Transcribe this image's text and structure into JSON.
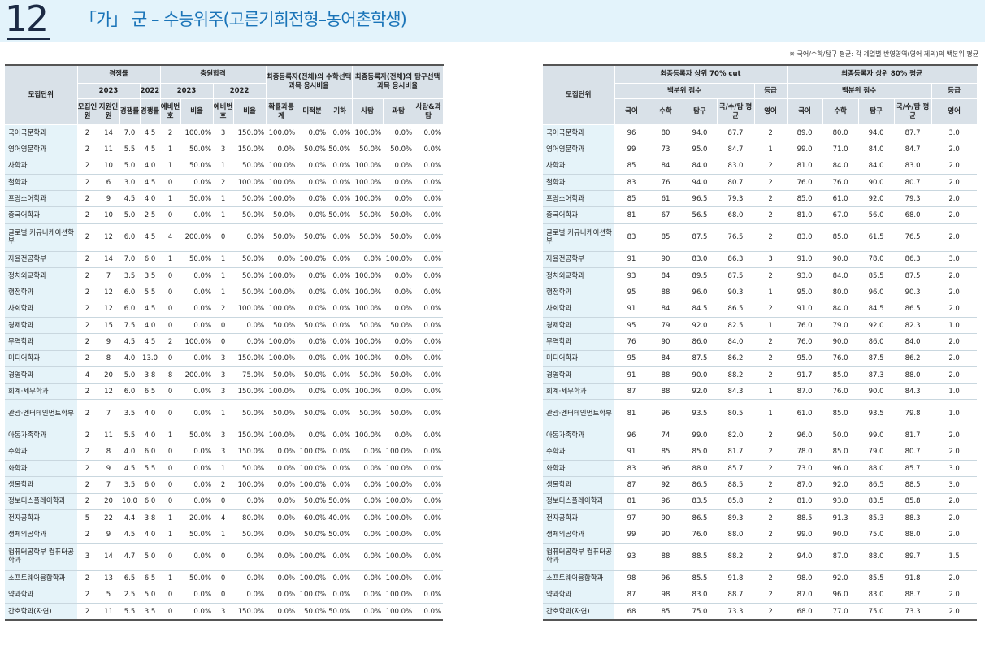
{
  "header": {
    "page_number": "12",
    "title": "「가」 군 – 수능위주(고른기회전형–농어촌학생)"
  },
  "note": "※ 국어/수학/탐구 평균: 각 계열별 반영영역(영어 제외)의 백분위 평균",
  "left_table": {
    "headers": {
      "unit": "모집단위",
      "competition": "경쟁률",
      "y2023": "2023",
      "y2022": "2022",
      "y2023b": "2023",
      "y2022b": "2022",
      "extra": "충원합격",
      "math_sel": "최종등록자(전체)의 수학선택과목 응시비율",
      "inq_sel": "최종등록자(전체)의 탐구선택과목 응시비율",
      "quota": "모집인원",
      "applicants": "지원인원",
      "rate2023": "경쟁률",
      "rate2022": "경쟁률",
      "wait2023": "예비번호",
      "ratio2023": "비율",
      "wait2022": "예비번호",
      "ratio2022": "비율",
      "prob": "확률과통계",
      "calc": "미적분",
      "geo": "기하",
      "soc": "사탐",
      "sci": "과탐",
      "mix": "사탐&과탐"
    },
    "rows": [
      {
        "name": "국어국문학과",
        "c": [
          "2",
          "14",
          "7.0",
          "4.5",
          "2",
          "100.0%",
          "3",
          "150.0%",
          "100.0%",
          "0.0%",
          "0.0%",
          "100.0%",
          "0.0%",
          "0.0%"
        ]
      },
      {
        "name": "영어영문학과",
        "c": [
          "2",
          "11",
          "5.5",
          "4.5",
          "1",
          "50.0%",
          "3",
          "150.0%",
          "0.0%",
          "50.0%",
          "50.0%",
          "50.0%",
          "50.0%",
          "0.0%"
        ]
      },
      {
        "name": "사학과",
        "c": [
          "2",
          "10",
          "5.0",
          "4.0",
          "1",
          "50.0%",
          "1",
          "50.0%",
          "100.0%",
          "0.0%",
          "0.0%",
          "100.0%",
          "0.0%",
          "0.0%"
        ]
      },
      {
        "name": "철학과",
        "c": [
          "2",
          "6",
          "3.0",
          "4.5",
          "0",
          "0.0%",
          "2",
          "100.0%",
          "100.0%",
          "0.0%",
          "0.0%",
          "100.0%",
          "0.0%",
          "0.0%"
        ]
      },
      {
        "name": "프랑스어학과",
        "c": [
          "2",
          "9",
          "4.5",
          "4.0",
          "1",
          "50.0%",
          "1",
          "50.0%",
          "100.0%",
          "0.0%",
          "0.0%",
          "100.0%",
          "0.0%",
          "0.0%"
        ]
      },
      {
        "name": "중국어학과",
        "c": [
          "2",
          "10",
          "5.0",
          "2.5",
          "0",
          "0.0%",
          "1",
          "50.0%",
          "50.0%",
          "0.0%",
          "50.0%",
          "50.0%",
          "50.0%",
          "0.0%"
        ]
      },
      {
        "name": "글로벌 커뮤니케이션학부",
        "tall": true,
        "c": [
          "2",
          "12",
          "6.0",
          "4.5",
          "4",
          "200.0%",
          "0",
          "0.0%",
          "50.0%",
          "50.0%",
          "0.0%",
          "50.0%",
          "50.0%",
          "0.0%"
        ]
      },
      {
        "name": "자율전공학부",
        "c": [
          "2",
          "14",
          "7.0",
          "6.0",
          "1",
          "50.0%",
          "1",
          "50.0%",
          "0.0%",
          "100.0%",
          "0.0%",
          "0.0%",
          "100.0%",
          "0.0%"
        ]
      },
      {
        "name": "정치외교학과",
        "c": [
          "2",
          "7",
          "3.5",
          "3.5",
          "0",
          "0.0%",
          "1",
          "50.0%",
          "100.0%",
          "0.0%",
          "0.0%",
          "100.0%",
          "0.0%",
          "0.0%"
        ]
      },
      {
        "name": "행정학과",
        "c": [
          "2",
          "12",
          "6.0",
          "5.5",
          "0",
          "0.0%",
          "1",
          "50.0%",
          "100.0%",
          "0.0%",
          "0.0%",
          "100.0%",
          "0.0%",
          "0.0%"
        ]
      },
      {
        "name": "사회학과",
        "c": [
          "2",
          "12",
          "6.0",
          "4.5",
          "0",
          "0.0%",
          "2",
          "100.0%",
          "100.0%",
          "0.0%",
          "0.0%",
          "100.0%",
          "0.0%",
          "0.0%"
        ]
      },
      {
        "name": "경제학과",
        "c": [
          "2",
          "15",
          "7.5",
          "4.0",
          "0",
          "0.0%",
          "0",
          "0.0%",
          "50.0%",
          "50.0%",
          "0.0%",
          "50.0%",
          "50.0%",
          "0.0%"
        ]
      },
      {
        "name": "무역학과",
        "c": [
          "2",
          "9",
          "4.5",
          "4.5",
          "2",
          "100.0%",
          "0",
          "0.0%",
          "100.0%",
          "0.0%",
          "0.0%",
          "100.0%",
          "0.0%",
          "0.0%"
        ]
      },
      {
        "name": "미디어학과",
        "c": [
          "2",
          "8",
          "4.0",
          "13.0",
          "0",
          "0.0%",
          "3",
          "150.0%",
          "100.0%",
          "0.0%",
          "0.0%",
          "100.0%",
          "0.0%",
          "0.0%"
        ]
      },
      {
        "name": "경영학과",
        "c": [
          "4",
          "20",
          "5.0",
          "3.8",
          "8",
          "200.0%",
          "3",
          "75.0%",
          "50.0%",
          "50.0%",
          "0.0%",
          "50.0%",
          "50.0%",
          "0.0%"
        ]
      },
      {
        "name": "회계·세무학과",
        "c": [
          "2",
          "12",
          "6.0",
          "6.5",
          "0",
          "0.0%",
          "3",
          "150.0%",
          "100.0%",
          "0.0%",
          "0.0%",
          "100.0%",
          "0.0%",
          "0.0%"
        ]
      },
      {
        "name": "관광·엔터테인먼트학부",
        "tall": true,
        "c": [
          "2",
          "7",
          "3.5",
          "4.0",
          "0",
          "0.0%",
          "1",
          "50.0%",
          "50.0%",
          "50.0%",
          "0.0%",
          "50.0%",
          "50.0%",
          "0.0%"
        ]
      },
      {
        "name": "아동가족학과",
        "c": [
          "2",
          "11",
          "5.5",
          "4.0",
          "1",
          "50.0%",
          "3",
          "150.0%",
          "100.0%",
          "0.0%",
          "0.0%",
          "100.0%",
          "0.0%",
          "0.0%"
        ]
      },
      {
        "name": "수학과",
        "c": [
          "2",
          "8",
          "4.0",
          "6.0",
          "0",
          "0.0%",
          "3",
          "150.0%",
          "0.0%",
          "100.0%",
          "0.0%",
          "0.0%",
          "100.0%",
          "0.0%"
        ]
      },
      {
        "name": "화학과",
        "c": [
          "2",
          "9",
          "4.5",
          "5.5",
          "0",
          "0.0%",
          "1",
          "50.0%",
          "0.0%",
          "100.0%",
          "0.0%",
          "0.0%",
          "100.0%",
          "0.0%"
        ]
      },
      {
        "name": "생물학과",
        "c": [
          "2",
          "7",
          "3.5",
          "6.0",
          "0",
          "0.0%",
          "2",
          "100.0%",
          "0.0%",
          "100.0%",
          "0.0%",
          "0.0%",
          "100.0%",
          "0.0%"
        ]
      },
      {
        "name": "정보디스플레이학과",
        "c": [
          "2",
          "20",
          "10.0",
          "6.0",
          "0",
          "0.0%",
          "0",
          "0.0%",
          "0.0%",
          "50.0%",
          "50.0%",
          "0.0%",
          "100.0%",
          "0.0%"
        ]
      },
      {
        "name": "전자공학과",
        "c": [
          "5",
          "22",
          "4.4",
          "3.8",
          "1",
          "20.0%",
          "4",
          "80.0%",
          "0.0%",
          "60.0%",
          "40.0%",
          "0.0%",
          "100.0%",
          "0.0%"
        ]
      },
      {
        "name": "생체의공학과",
        "c": [
          "2",
          "9",
          "4.5",
          "4.0",
          "1",
          "50.0%",
          "1",
          "50.0%",
          "0.0%",
          "50.0%",
          "50.0%",
          "0.0%",
          "100.0%",
          "0.0%"
        ]
      },
      {
        "name": "컴퓨터공학부 컴퓨터공학과",
        "tall": true,
        "c": [
          "3",
          "14",
          "4.7",
          "5.0",
          "0",
          "0.0%",
          "0",
          "0.0%",
          "0.0%",
          "100.0%",
          "0.0%",
          "0.0%",
          "100.0%",
          "0.0%"
        ]
      },
      {
        "name": "소프트웨어융합학과",
        "c": [
          "2",
          "13",
          "6.5",
          "6.5",
          "1",
          "50.0%",
          "0",
          "0.0%",
          "0.0%",
          "100.0%",
          "0.0%",
          "0.0%",
          "100.0%",
          "0.0%"
        ]
      },
      {
        "name": "약과학과",
        "c": [
          "2",
          "5",
          "2.5",
          "5.0",
          "0",
          "0.0%",
          "0",
          "0.0%",
          "0.0%",
          "100.0%",
          "0.0%",
          "0.0%",
          "100.0%",
          "0.0%"
        ]
      },
      {
        "name": "간호학과(자연)",
        "c": [
          "2",
          "11",
          "5.5",
          "3.5",
          "0",
          "0.0%",
          "3",
          "150.0%",
          "0.0%",
          "50.0%",
          "50.0%",
          "0.0%",
          "100.0%",
          "0.0%"
        ]
      }
    ]
  },
  "right_table": {
    "headers": {
      "unit": "모집단위",
      "cut70": "최종등록자 상위 70% cut",
      "avg80": "최종등록자 상위 80% 평균",
      "pct": "백분위 점수",
      "grade": "등급",
      "pct2": "백분위 점수",
      "grade2": "등급",
      "kor": "국어",
      "math": "수학",
      "inq": "탐구",
      "avg": "국/수/탐 평균",
      "eng": "영어",
      "kor2": "국어",
      "math2": "수학",
      "inq2": "탐구",
      "avg2": "국/수/탐 평균",
      "eng2": "영어"
    },
    "rows": [
      {
        "name": "국어국문학과",
        "c": [
          "96",
          "80",
          "94.0",
          "87.7",
          "2",
          "89.0",
          "80.0",
          "94.0",
          "87.7",
          "3.0"
        ]
      },
      {
        "name": "영어영문학과",
        "c": [
          "99",
          "73",
          "95.0",
          "84.7",
          "1",
          "99.0",
          "71.0",
          "84.0",
          "84.7",
          "2.0"
        ]
      },
      {
        "name": "사학과",
        "c": [
          "85",
          "84",
          "84.0",
          "83.0",
          "2",
          "81.0",
          "84.0",
          "84.0",
          "83.0",
          "2.0"
        ]
      },
      {
        "name": "철학과",
        "c": [
          "83",
          "76",
          "94.0",
          "80.7",
          "2",
          "76.0",
          "76.0",
          "90.0",
          "80.7",
          "2.0"
        ]
      },
      {
        "name": "프랑스어학과",
        "c": [
          "85",
          "61",
          "96.5",
          "79.3",
          "2",
          "85.0",
          "61.0",
          "92.0",
          "79.3",
          "2.0"
        ]
      },
      {
        "name": "중국어학과",
        "c": [
          "81",
          "67",
          "56.5",
          "68.0",
          "2",
          "81.0",
          "67.0",
          "56.0",
          "68.0",
          "2.0"
        ]
      },
      {
        "name": "글로벌 커뮤니케이션학부",
        "tall": true,
        "c": [
          "83",
          "85",
          "87.5",
          "76.5",
          "2",
          "83.0",
          "85.0",
          "61.5",
          "76.5",
          "2.0"
        ]
      },
      {
        "name": "자율전공학부",
        "c": [
          "91",
          "90",
          "83.0",
          "86.3",
          "3",
          "91.0",
          "90.0",
          "78.0",
          "86.3",
          "3.0"
        ]
      },
      {
        "name": "정치외교학과",
        "c": [
          "93",
          "84",
          "89.5",
          "87.5",
          "2",
          "93.0",
          "84.0",
          "85.5",
          "87.5",
          "2.0"
        ]
      },
      {
        "name": "행정학과",
        "c": [
          "95",
          "88",
          "96.0",
          "90.3",
          "1",
          "95.0",
          "80.0",
          "96.0",
          "90.3",
          "2.0"
        ]
      },
      {
        "name": "사회학과",
        "c": [
          "91",
          "84",
          "84.5",
          "86.5",
          "2",
          "91.0",
          "84.0",
          "84.5",
          "86.5",
          "2.0"
        ]
      },
      {
        "name": "경제학과",
        "c": [
          "95",
          "79",
          "92.0",
          "82.5",
          "1",
          "76.0",
          "79.0",
          "92.0",
          "82.3",
          "1.0"
        ]
      },
      {
        "name": "무역학과",
        "c": [
          "76",
          "90",
          "86.0",
          "84.0",
          "2",
          "76.0",
          "90.0",
          "86.0",
          "84.0",
          "2.0"
        ]
      },
      {
        "name": "미디어학과",
        "c": [
          "95",
          "84",
          "87.5",
          "86.2",
          "2",
          "95.0",
          "76.0",
          "87.5",
          "86.2",
          "2.0"
        ]
      },
      {
        "name": "경영학과",
        "c": [
          "91",
          "88",
          "90.0",
          "88.2",
          "2",
          "91.7",
          "85.0",
          "87.3",
          "88.0",
          "2.0"
        ]
      },
      {
        "name": "회계·세무학과",
        "c": [
          "87",
          "88",
          "92.0",
          "84.3",
          "1",
          "87.0",
          "76.0",
          "90.0",
          "84.3",
          "1.0"
        ]
      },
      {
        "name": "관광·엔터테인먼트학부",
        "tall": true,
        "c": [
          "81",
          "96",
          "93.5",
          "80.5",
          "1",
          "61.0",
          "85.0",
          "93.5",
          "79.8",
          "1.0"
        ]
      },
      {
        "name": "아동가족학과",
        "c": [
          "96",
          "74",
          "99.0",
          "82.0",
          "2",
          "96.0",
          "50.0",
          "99.0",
          "81.7",
          "2.0"
        ]
      },
      {
        "name": "수학과",
        "c": [
          "91",
          "85",
          "85.0",
          "81.7",
          "2",
          "78.0",
          "85.0",
          "79.0",
          "80.7",
          "2.0"
        ]
      },
      {
        "name": "화학과",
        "c": [
          "83",
          "96",
          "88.0",
          "85.7",
          "2",
          "73.0",
          "96.0",
          "88.0",
          "85.7",
          "3.0"
        ]
      },
      {
        "name": "생물학과",
        "c": [
          "87",
          "92",
          "86.5",
          "88.5",
          "2",
          "87.0",
          "92.0",
          "86.5",
          "88.5",
          "3.0"
        ]
      },
      {
        "name": "정보디스플레이학과",
        "c": [
          "81",
          "96",
          "83.5",
          "85.8",
          "2",
          "81.0",
          "93.0",
          "83.5",
          "85.8",
          "2.0"
        ]
      },
      {
        "name": "전자공학과",
        "c": [
          "97",
          "90",
          "86.5",
          "89.3",
          "2",
          "88.5",
          "91.3",
          "85.3",
          "88.3",
          "2.0"
        ]
      },
      {
        "name": "생체의공학과",
        "c": [
          "99",
          "90",
          "76.0",
          "88.0",
          "2",
          "99.0",
          "90.0",
          "75.0",
          "88.0",
          "2.0"
        ]
      },
      {
        "name": "컴퓨터공학부 컴퓨터공학과",
        "tall": true,
        "c": [
          "93",
          "88",
          "88.5",
          "88.2",
          "2",
          "94.0",
          "87.0",
          "88.0",
          "89.7",
          "1.5"
        ]
      },
      {
        "name": "소프트웨어융합학과",
        "c": [
          "98",
          "96",
          "85.5",
          "91.8",
          "2",
          "98.0",
          "92.0",
          "85.5",
          "91.8",
          "2.0"
        ]
      },
      {
        "name": "약과학과",
        "c": [
          "87",
          "98",
          "83.0",
          "88.7",
          "2",
          "87.0",
          "96.0",
          "83.0",
          "88.7",
          "2.0"
        ]
      },
      {
        "name": "간호학과(자연)",
        "c": [
          "68",
          "85",
          "75.0",
          "73.3",
          "2",
          "68.0",
          "77.0",
          "75.0",
          "73.3",
          "2.0"
        ]
      }
    ]
  }
}
